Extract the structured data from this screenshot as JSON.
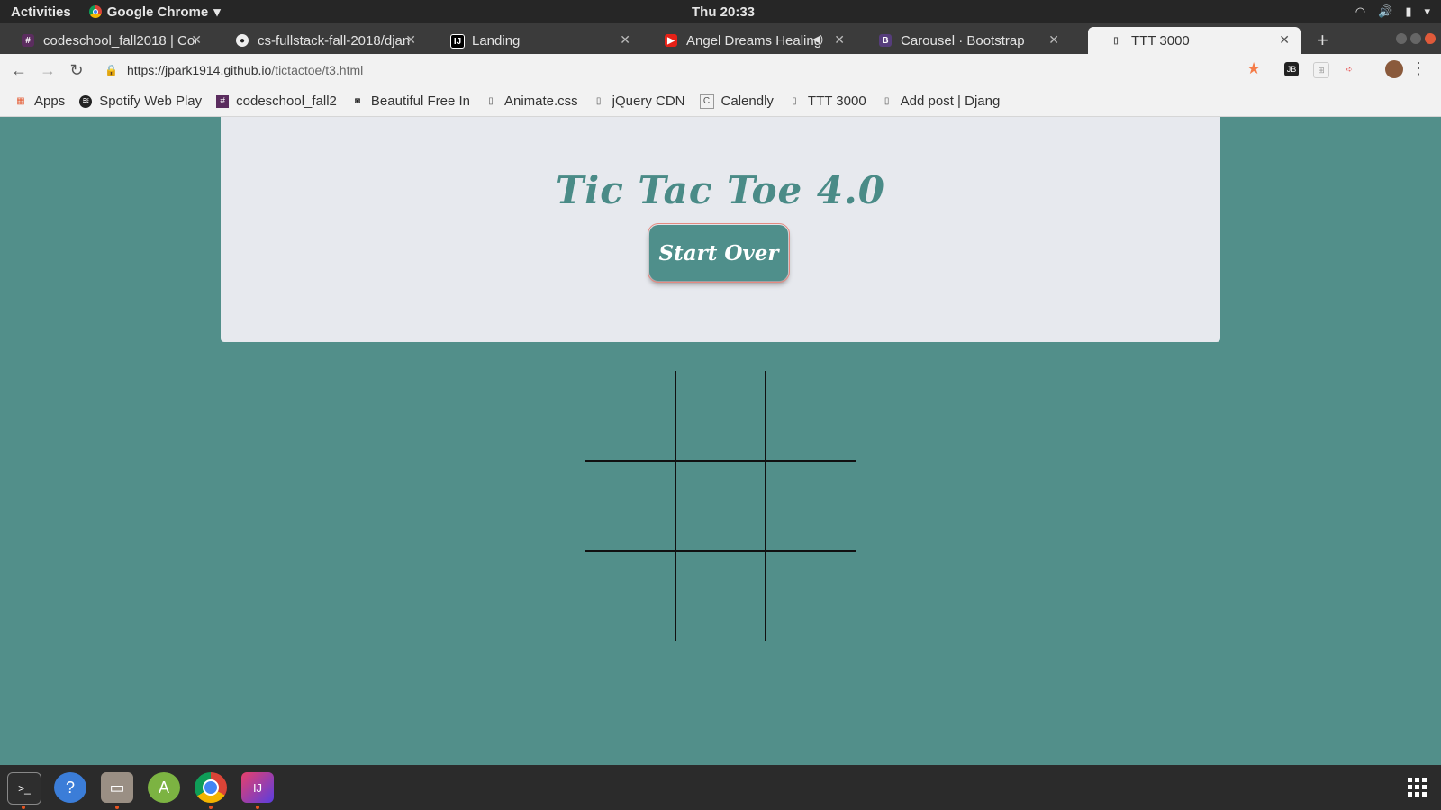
{
  "system_bar": {
    "activities": "Activities",
    "app_name": "Google Chrome",
    "clock": "Thu 20:33"
  },
  "tabs": [
    {
      "label": "codeschool_fall2018 | Coc",
      "icon": "slack-hash-icon"
    },
    {
      "label": "cs-fullstack-fall-2018/djan",
      "icon": "github-icon"
    },
    {
      "label": "Landing",
      "icon": "intellij-icon"
    },
    {
      "label": "Angel Dreams Healing",
      "icon": "youtube-icon",
      "muted_indicator": "audio-icon"
    },
    {
      "label": "Carousel · Bootstrap",
      "icon": "bootstrap-icon"
    },
    {
      "label": "TTT 3000",
      "icon": "page-icon",
      "active": true
    }
  ],
  "address_bar": {
    "host": "https://jpark1914.github.io",
    "path": "/tictactoe/t3.html"
  },
  "bookmarks": [
    {
      "label": "Apps",
      "icon": "apps-grid-icon"
    },
    {
      "label": "Spotify Web Play",
      "icon": "spotify-icon"
    },
    {
      "label": "codeschool_fall2",
      "icon": "slack-hash-icon"
    },
    {
      "label": "Beautiful Free In",
      "icon": "camera-icon"
    },
    {
      "label": "Animate.css",
      "icon": "page-icon"
    },
    {
      "label": "jQuery CDN",
      "icon": "page-icon"
    },
    {
      "label": "Calendly",
      "icon": "calendly-icon"
    },
    {
      "label": "TTT 3000",
      "icon": "page-icon"
    },
    {
      "label": "Add post | Djang",
      "icon": "page-icon"
    }
  ],
  "game": {
    "title": "Tic Tac Toe 4.0",
    "start_over_label": "Start Over",
    "board": [
      "",
      "",
      "",
      "",
      "",
      "",
      "",
      "",
      ""
    ]
  },
  "colors": {
    "page_background": "#528f8a",
    "card_background": "#e7e9ee",
    "accent": "#4a8b87"
  },
  "dock_apps": [
    "terminal-icon",
    "help-icon",
    "files-icon",
    "android-studio-icon",
    "chrome-icon",
    "intellij-icon"
  ]
}
